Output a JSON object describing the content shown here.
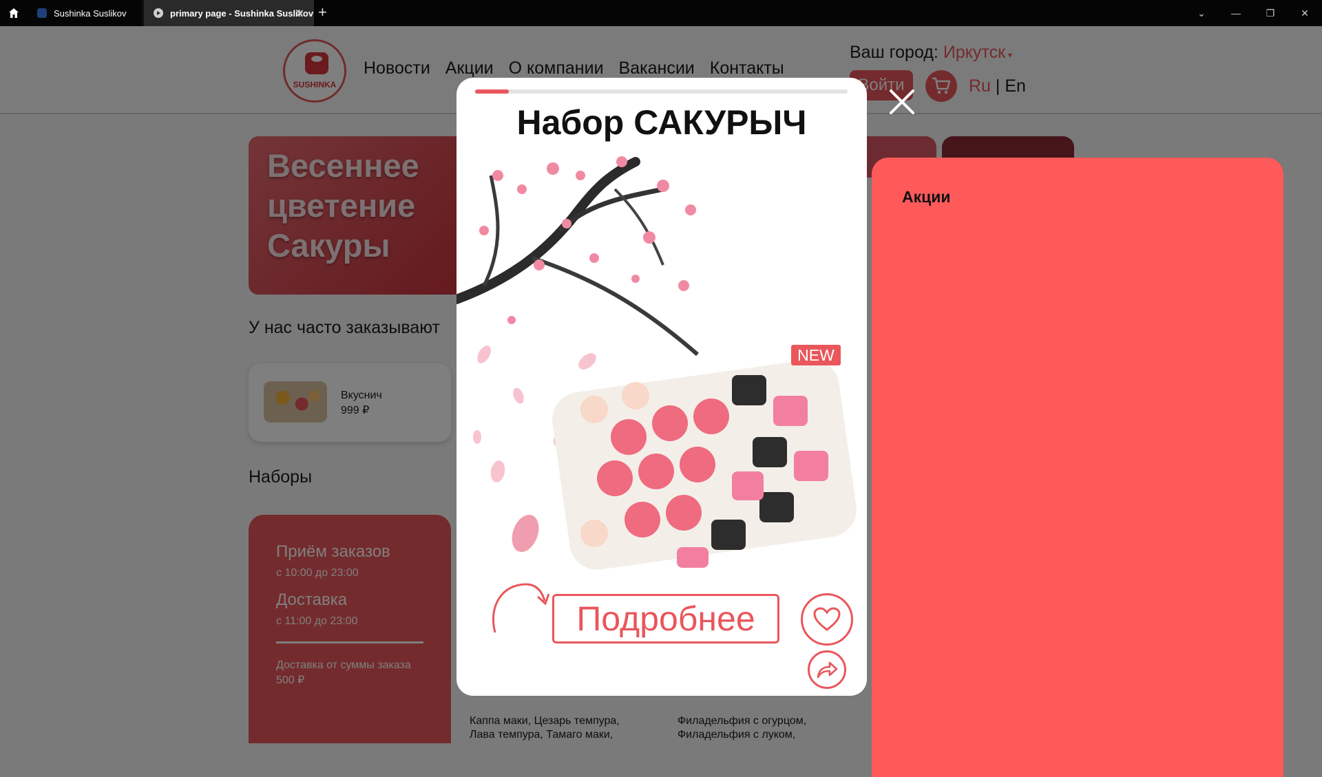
{
  "browser": {
    "tabs": [
      {
        "title": "Sushinka Suslikov"
      },
      {
        "title": "primary page - Sushinka Suslikov"
      }
    ],
    "new_tab": "+",
    "close_tab": "✕",
    "controls": {
      "dropdown": "⌄",
      "minimize": "—",
      "restore": "❐",
      "close": "✕"
    }
  },
  "header": {
    "logo_text": "SUSHINKA",
    "nav": [
      "Новости",
      "Акции",
      "О компании",
      "Вакансии",
      "Контакты"
    ],
    "city_label": "Ваш город:",
    "city_value": "Иркутск",
    "city_arrow": "▾",
    "login": "Войти",
    "lang_ru": "Ru",
    "lang_sep": " | ",
    "lang_en": "En"
  },
  "promo": {
    "title_line1": "Весеннее",
    "title_line2": "цветение",
    "title_line3": "Сакуры"
  },
  "popular": {
    "title": "У нас часто заказывают",
    "item_name": "Вкуснич",
    "item_price": "999 ₽"
  },
  "sets": {
    "title": "Наборы"
  },
  "info": {
    "orders_title": "Приём заказов",
    "orders_hours": "с 10:00 до 23:00",
    "delivery_title": "Доставка",
    "delivery_hours": "с 11:00 до 23:00",
    "note": "Доставка от суммы заказа 500 ₽"
  },
  "lists": {
    "col1": "Каппа маки, Цезарь темпура,\nЛава темпура, Тамаго маки,\nФиладельфия лосось лайт.",
    "col2": "Филадельфия с огурцом,\nФиладельфия с луком,\nЦезарь темпура,"
  },
  "side_panel": {
    "title": "Акции"
  },
  "modal": {
    "progress": 0.09,
    "title": "Набор САКУРЫЧ",
    "badge": "NEW",
    "more_button": "Подробнее"
  },
  "colors": {
    "accent": "#e9565b",
    "panel": "#ff5a5a",
    "chrome": "#050505"
  },
  "icons": [
    "home-icon",
    "cart-icon",
    "heart-icon",
    "share-icon",
    "close-icon",
    "curved-arrow-icon"
  ]
}
